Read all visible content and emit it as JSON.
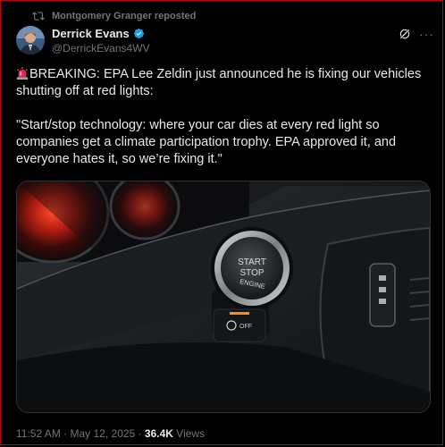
{
  "repost": {
    "text": "Montgomery Granger reposted",
    "icon": "repost-icon"
  },
  "author": {
    "name": "Derrick Evans",
    "handle": "@DerrickEvans4WV",
    "verified_color": "#1d9bf0"
  },
  "tweet": {
    "line1": "BREAKING: EPA Lee Zeldin just announced he is fixing our vehicles shutting off at red lights:",
    "line2": "\"Start/stop technology: where your car dies at every red light so companies get a climate participation trophy. EPA approved it, and everyone hates it, so we’re fixing it.\""
  },
  "media": {
    "button_line1": "START",
    "button_line2": "STOP",
    "button_line3": "ENGINE",
    "off_label": "OFF"
  },
  "meta": {
    "time": "11:52 AM",
    "sep1": "·",
    "date": "May 12, 2025",
    "sep2": "·",
    "views_count": "36.4K",
    "views_label": "Views"
  },
  "colors": {
    "background": "#000000",
    "text": "#e7e9ea",
    "secondary": "#71767b",
    "accent": "#1d9bf0"
  }
}
